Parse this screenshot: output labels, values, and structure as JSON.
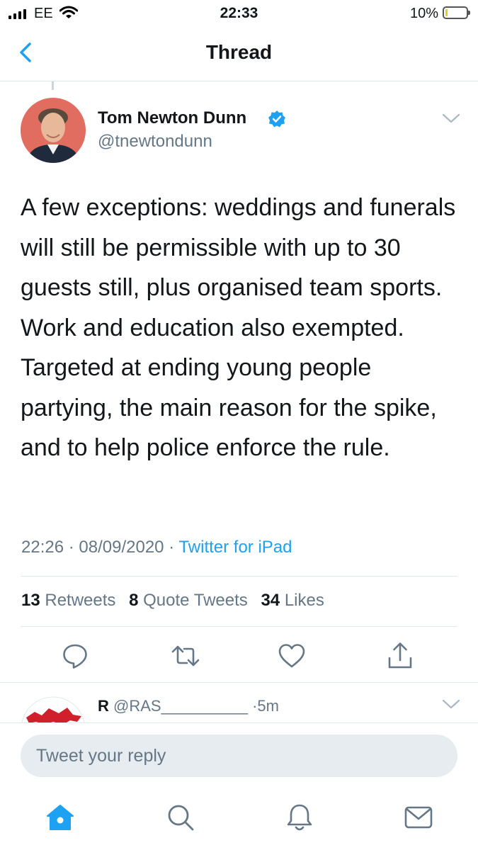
{
  "status_bar": {
    "carrier": "EE",
    "time": "22:33",
    "battery_percent": "10%",
    "battery_level": 0.1,
    "battery_color": "#f5c51a"
  },
  "nav": {
    "title": "Thread",
    "back_icon": "chevron-left-icon"
  },
  "tweet": {
    "author_name": "Tom Newton Dunn",
    "handle": "@tnewtondunn",
    "verified": true,
    "text": "A few exceptions: weddings and funerals will still be permissible with up to 30 guests still, plus organised team sports. Work and education also exempted. Targeted at ending young people partying, the main reason for the spike, and to help police enforce the rule.",
    "time": "22:26",
    "date": "08/09/2020",
    "separator": "·",
    "source": "Twitter for iPad",
    "stats": {
      "retweets_count": "13",
      "retweets_label": "Retweets",
      "quotes_count": "8",
      "quotes_label": "Quote Tweets",
      "likes_count": "34",
      "likes_label": "Likes"
    },
    "actions": [
      "reply-icon",
      "retweet-icon",
      "like-icon",
      "share-icon"
    ]
  },
  "reply_preview": {
    "name": "R",
    "handle": "@RAS__________",
    "separator": "·",
    "time": "5m"
  },
  "composer": {
    "placeholder": "Tweet your reply"
  },
  "tab_bar": [
    "home-icon",
    "search-icon",
    "notifications-icon",
    "messages-icon"
  ],
  "colors": {
    "accent": "#1da1f2",
    "secondary_text": "#657786",
    "divider": "#e1e8ed"
  }
}
